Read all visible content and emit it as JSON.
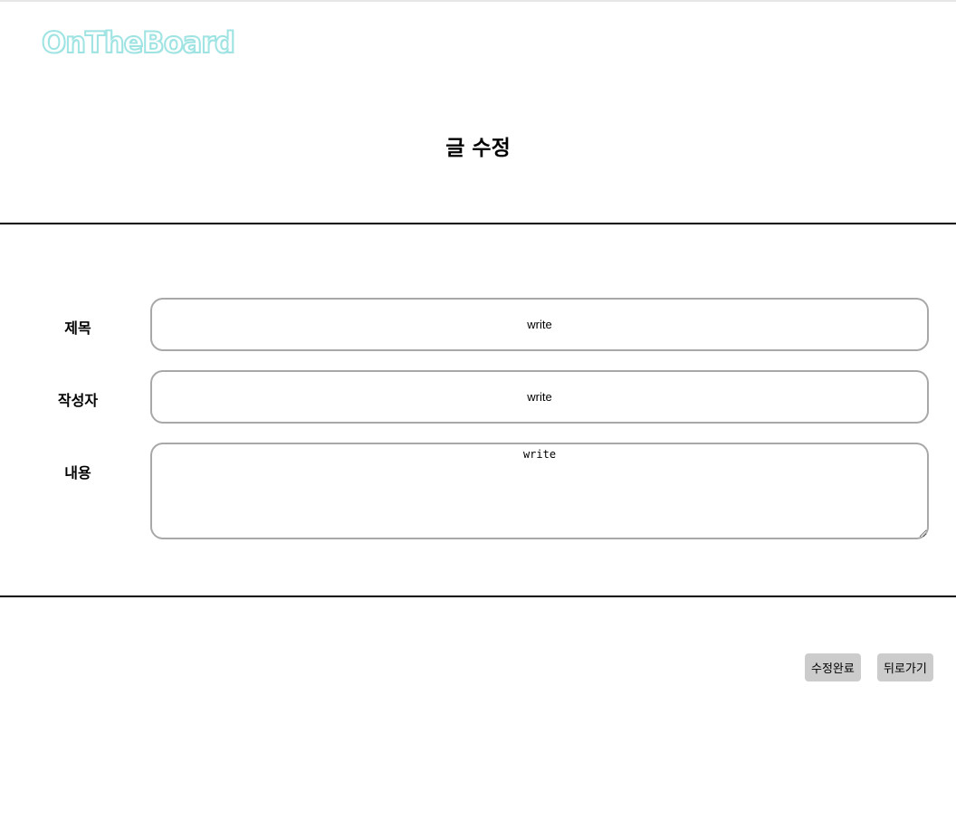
{
  "header": {
    "logo_text": "OnTheBoard",
    "logo_color": "#9fe3e3"
  },
  "page": {
    "title": "글 수정"
  },
  "form": {
    "title_label": "제목",
    "title_value": "write",
    "author_label": "작성자",
    "author_value": "write",
    "content_label": "내용",
    "content_value": "write"
  },
  "actions": {
    "submit_label": "수정완료",
    "back_label": "뒤로가기",
    "button_color": "#cccccc"
  }
}
